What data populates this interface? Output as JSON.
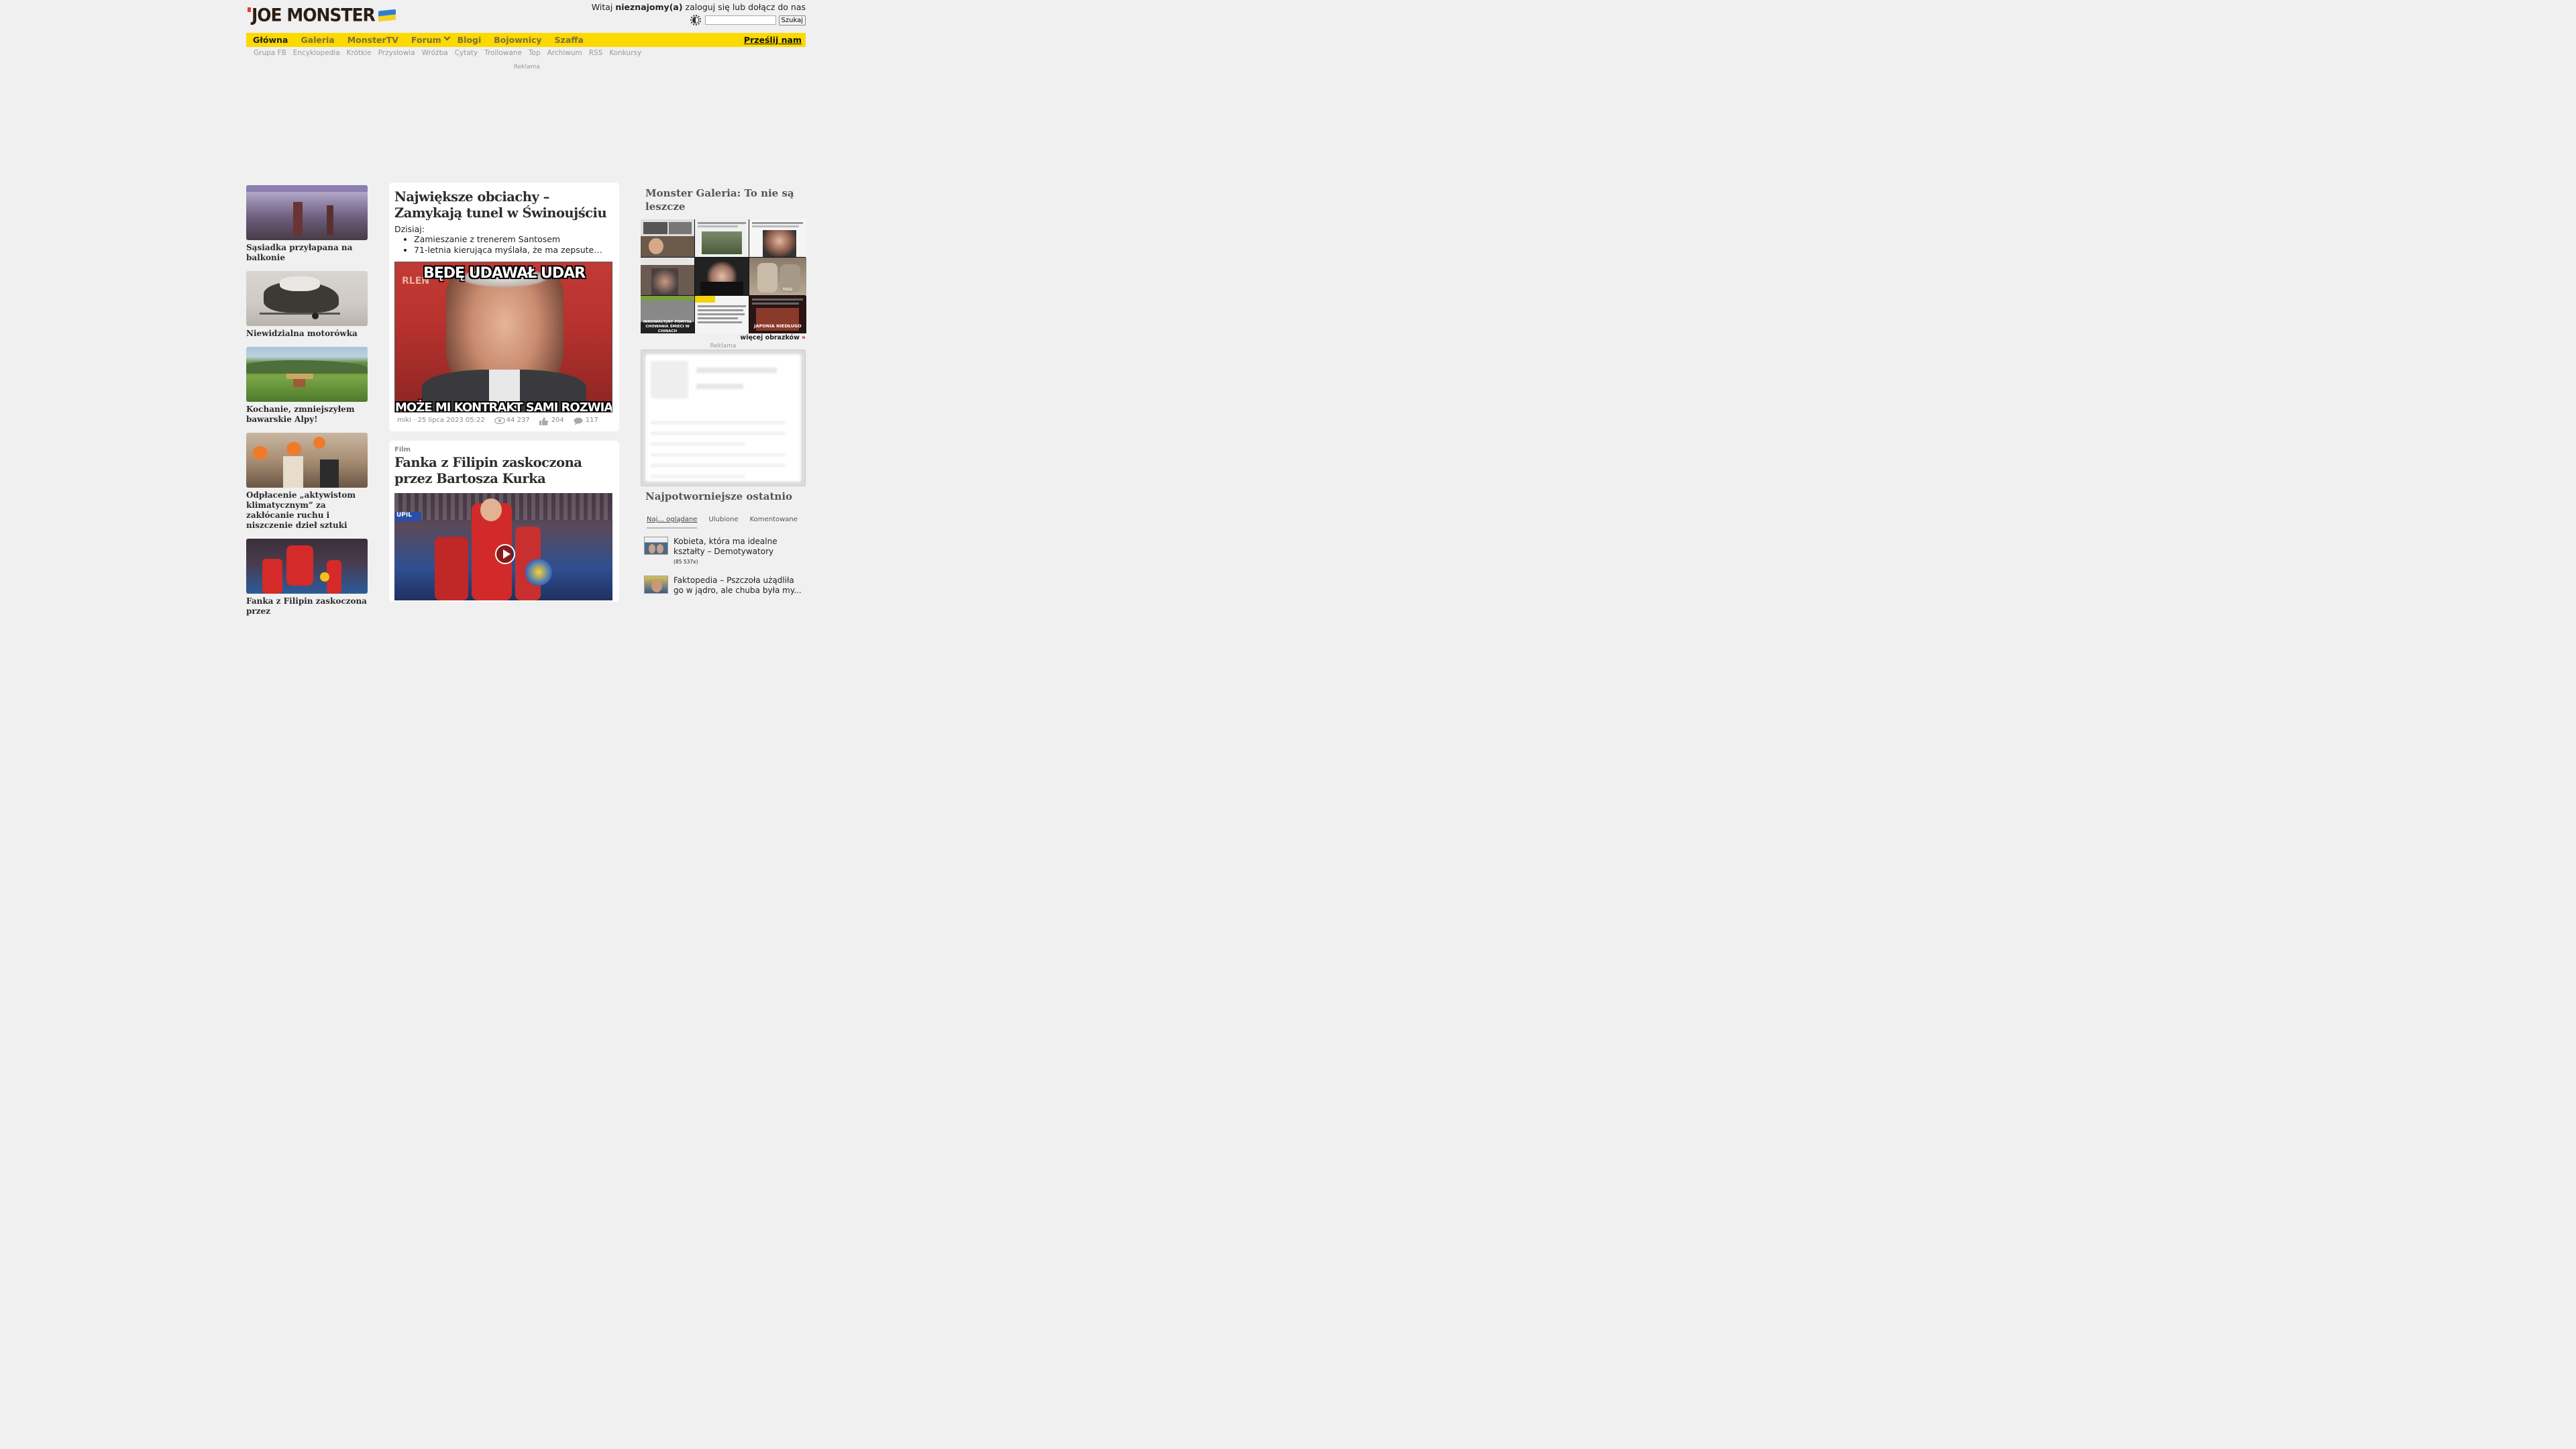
{
  "header": {
    "logo_text": "JOE MONSTER",
    "greeting_prefix": "Witaj ",
    "greeting_user": "nieznajomy(a)",
    "greeting_suffix": " zaloguj się lub dołącz do nas",
    "search_placeholder": "",
    "search_button": "Szukaj"
  },
  "nav": {
    "items": [
      "Główna",
      "Galeria",
      "MonsterTV",
      "Forum",
      "Blogi",
      "Bojownicy",
      "Szaffa"
    ],
    "submit": "Prześlij nam"
  },
  "subnav": [
    "Grupa FB",
    "Encyklopedia",
    "Krótkie",
    "Przysłowia",
    "Wróżba",
    "Cytaty",
    "Trollowane",
    "Top",
    "Archiwum",
    "RSS",
    "Konkursy"
  ],
  "ad_label": "Reklama",
  "left_tiles": [
    {
      "title": "Sąsiadka przyłapana na balkonie"
    },
    {
      "title": "Niewidzialna motorówka"
    },
    {
      "title": "Kochanie, zmniejszyłem bawarskie Alpy!"
    },
    {
      "title": "Odpłacenie „aktywistom klimatycznym” za zakłócanie ruchu i niszczenie dzieł sztuki"
    },
    {
      "title": "Fanka z Filipin zaskoczona przez"
    }
  ],
  "article1": {
    "title": "Największe obciachy – Zamykają tunel w Świnoujściu",
    "today_label": "Dzisiaj:",
    "bullets": [
      "Zamieszanie z trenerem Santosem",
      "71-letnia kierująca myślała, że ma zepsute…"
    ],
    "image_top_text": "BĘDĘ UDAWAŁ UDAR",
    "image_bottom_text": "MOŻE MI KONTRAKT SAMI ROZWIĄŻĄ",
    "author_date": "miki · 25 lipca 2023 05:22",
    "views": "44 237",
    "likes": "204",
    "comments": "117"
  },
  "article2": {
    "category": "Film",
    "title": "Fanka z Filipin zaskoczona przez Bartosza Kurka"
  },
  "gallery": {
    "title": "Monster Galeria: To nie są leszcze",
    "more": "więcej obrazków",
    "more_arrow": "»",
    "thumb_texts": [
      "INNOWACYJNY POMYSŁ CHOWANIA ŚMIECI W CHINACH",
      "JAPONIA NIEDŁUGO",
      "Mała"
    ]
  },
  "popular": {
    "title": "Najpotworniejsze ostatnio",
    "tabs": [
      "Naj... oglądane",
      "Ulubione",
      "Komentowane"
    ],
    "items": [
      {
        "title": "Kobieta, która ma idealne kształty – Demotywatory",
        "count": "(85 537x)"
      },
      {
        "title": "Faktopedia – Pszczoła użądliła go w jądro, ale chuba była my...",
        "count": ""
      }
    ]
  }
}
